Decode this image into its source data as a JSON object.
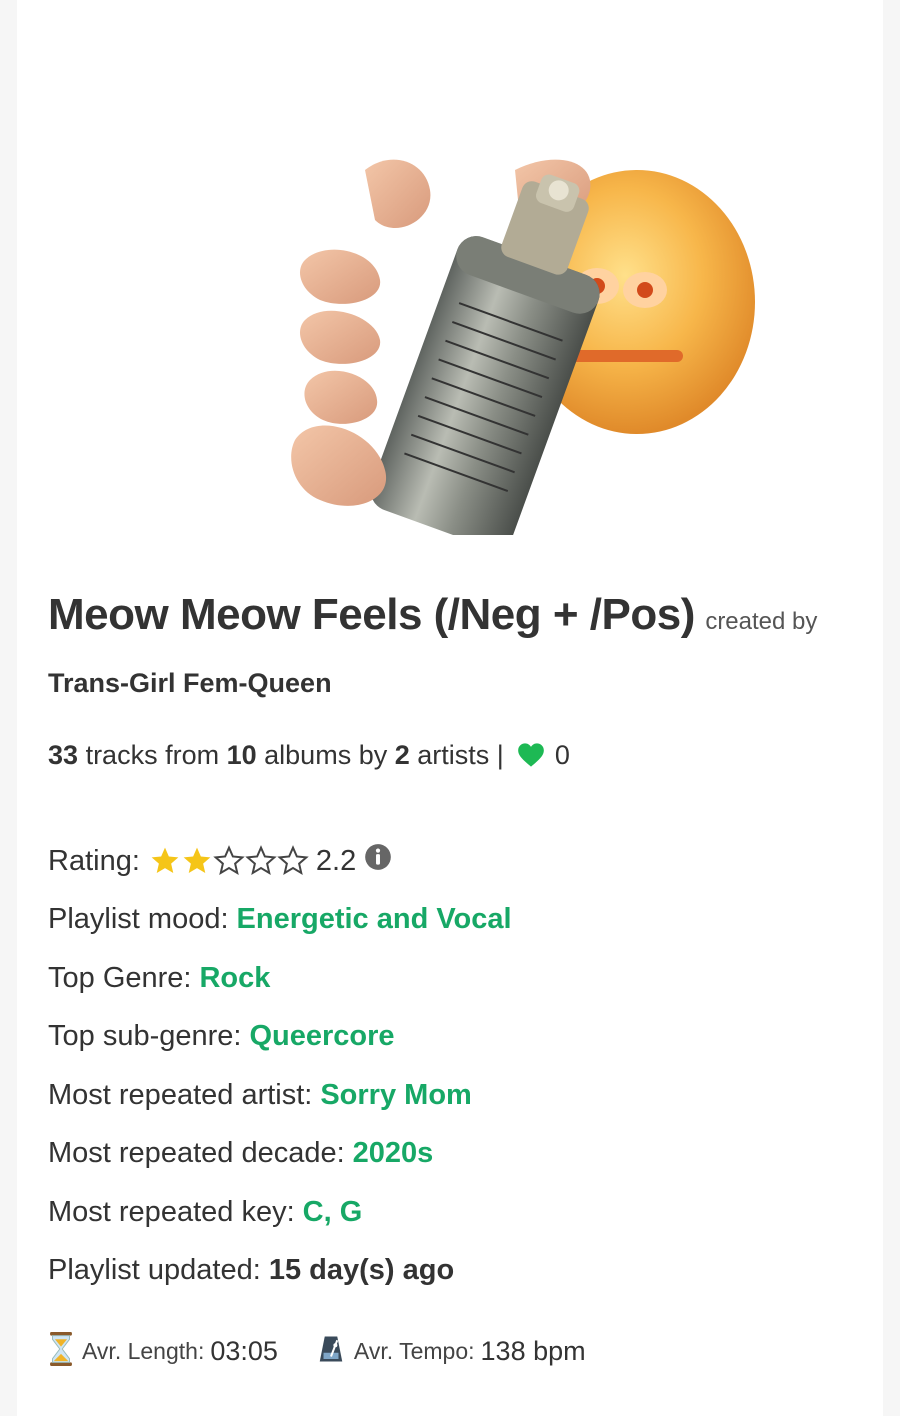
{
  "playlist": {
    "title": "Meow Meow Feels (/Neg + /Pos)",
    "created_by_label": "created by",
    "creator": "Trans-Girl Fem-Queen",
    "cover_image": "hand holding spray can next to cursed emoji face"
  },
  "stats": {
    "tracks": "33",
    "tracks_label": "tracks from",
    "albums": "10",
    "albums_label": "albums by",
    "artists": "2",
    "artists_label": "artists |",
    "likes": "0",
    "like_icon": "heart-icon"
  },
  "details": {
    "rating_label": "Rating:",
    "rating_value": "2.2",
    "rating_stars": 2.2,
    "mood_label": "Playlist mood:",
    "mood_value": "Energetic and Vocal",
    "genre_label": "Top Genre:",
    "genre_value": "Rock",
    "subgenre_label": "Top sub-genre:",
    "subgenre_value": "Queercore",
    "artist_label": "Most repeated artist:",
    "artist_value": "Sorry Mom",
    "decade_label": "Most repeated decade:",
    "decade_value": "2020s",
    "key_label": "Most repeated key:",
    "key_value": "C, G",
    "updated_label": "Playlist updated:",
    "updated_value": "15 day(s) ago"
  },
  "footer": {
    "length_label": "Avr. Length:",
    "length_value": "03:05",
    "tempo_label": "Avr. Tempo:",
    "tempo_value": "138 bpm"
  },
  "colors": {
    "accent": "#17a866",
    "star": "#f5c518",
    "heart": "#1db954"
  }
}
